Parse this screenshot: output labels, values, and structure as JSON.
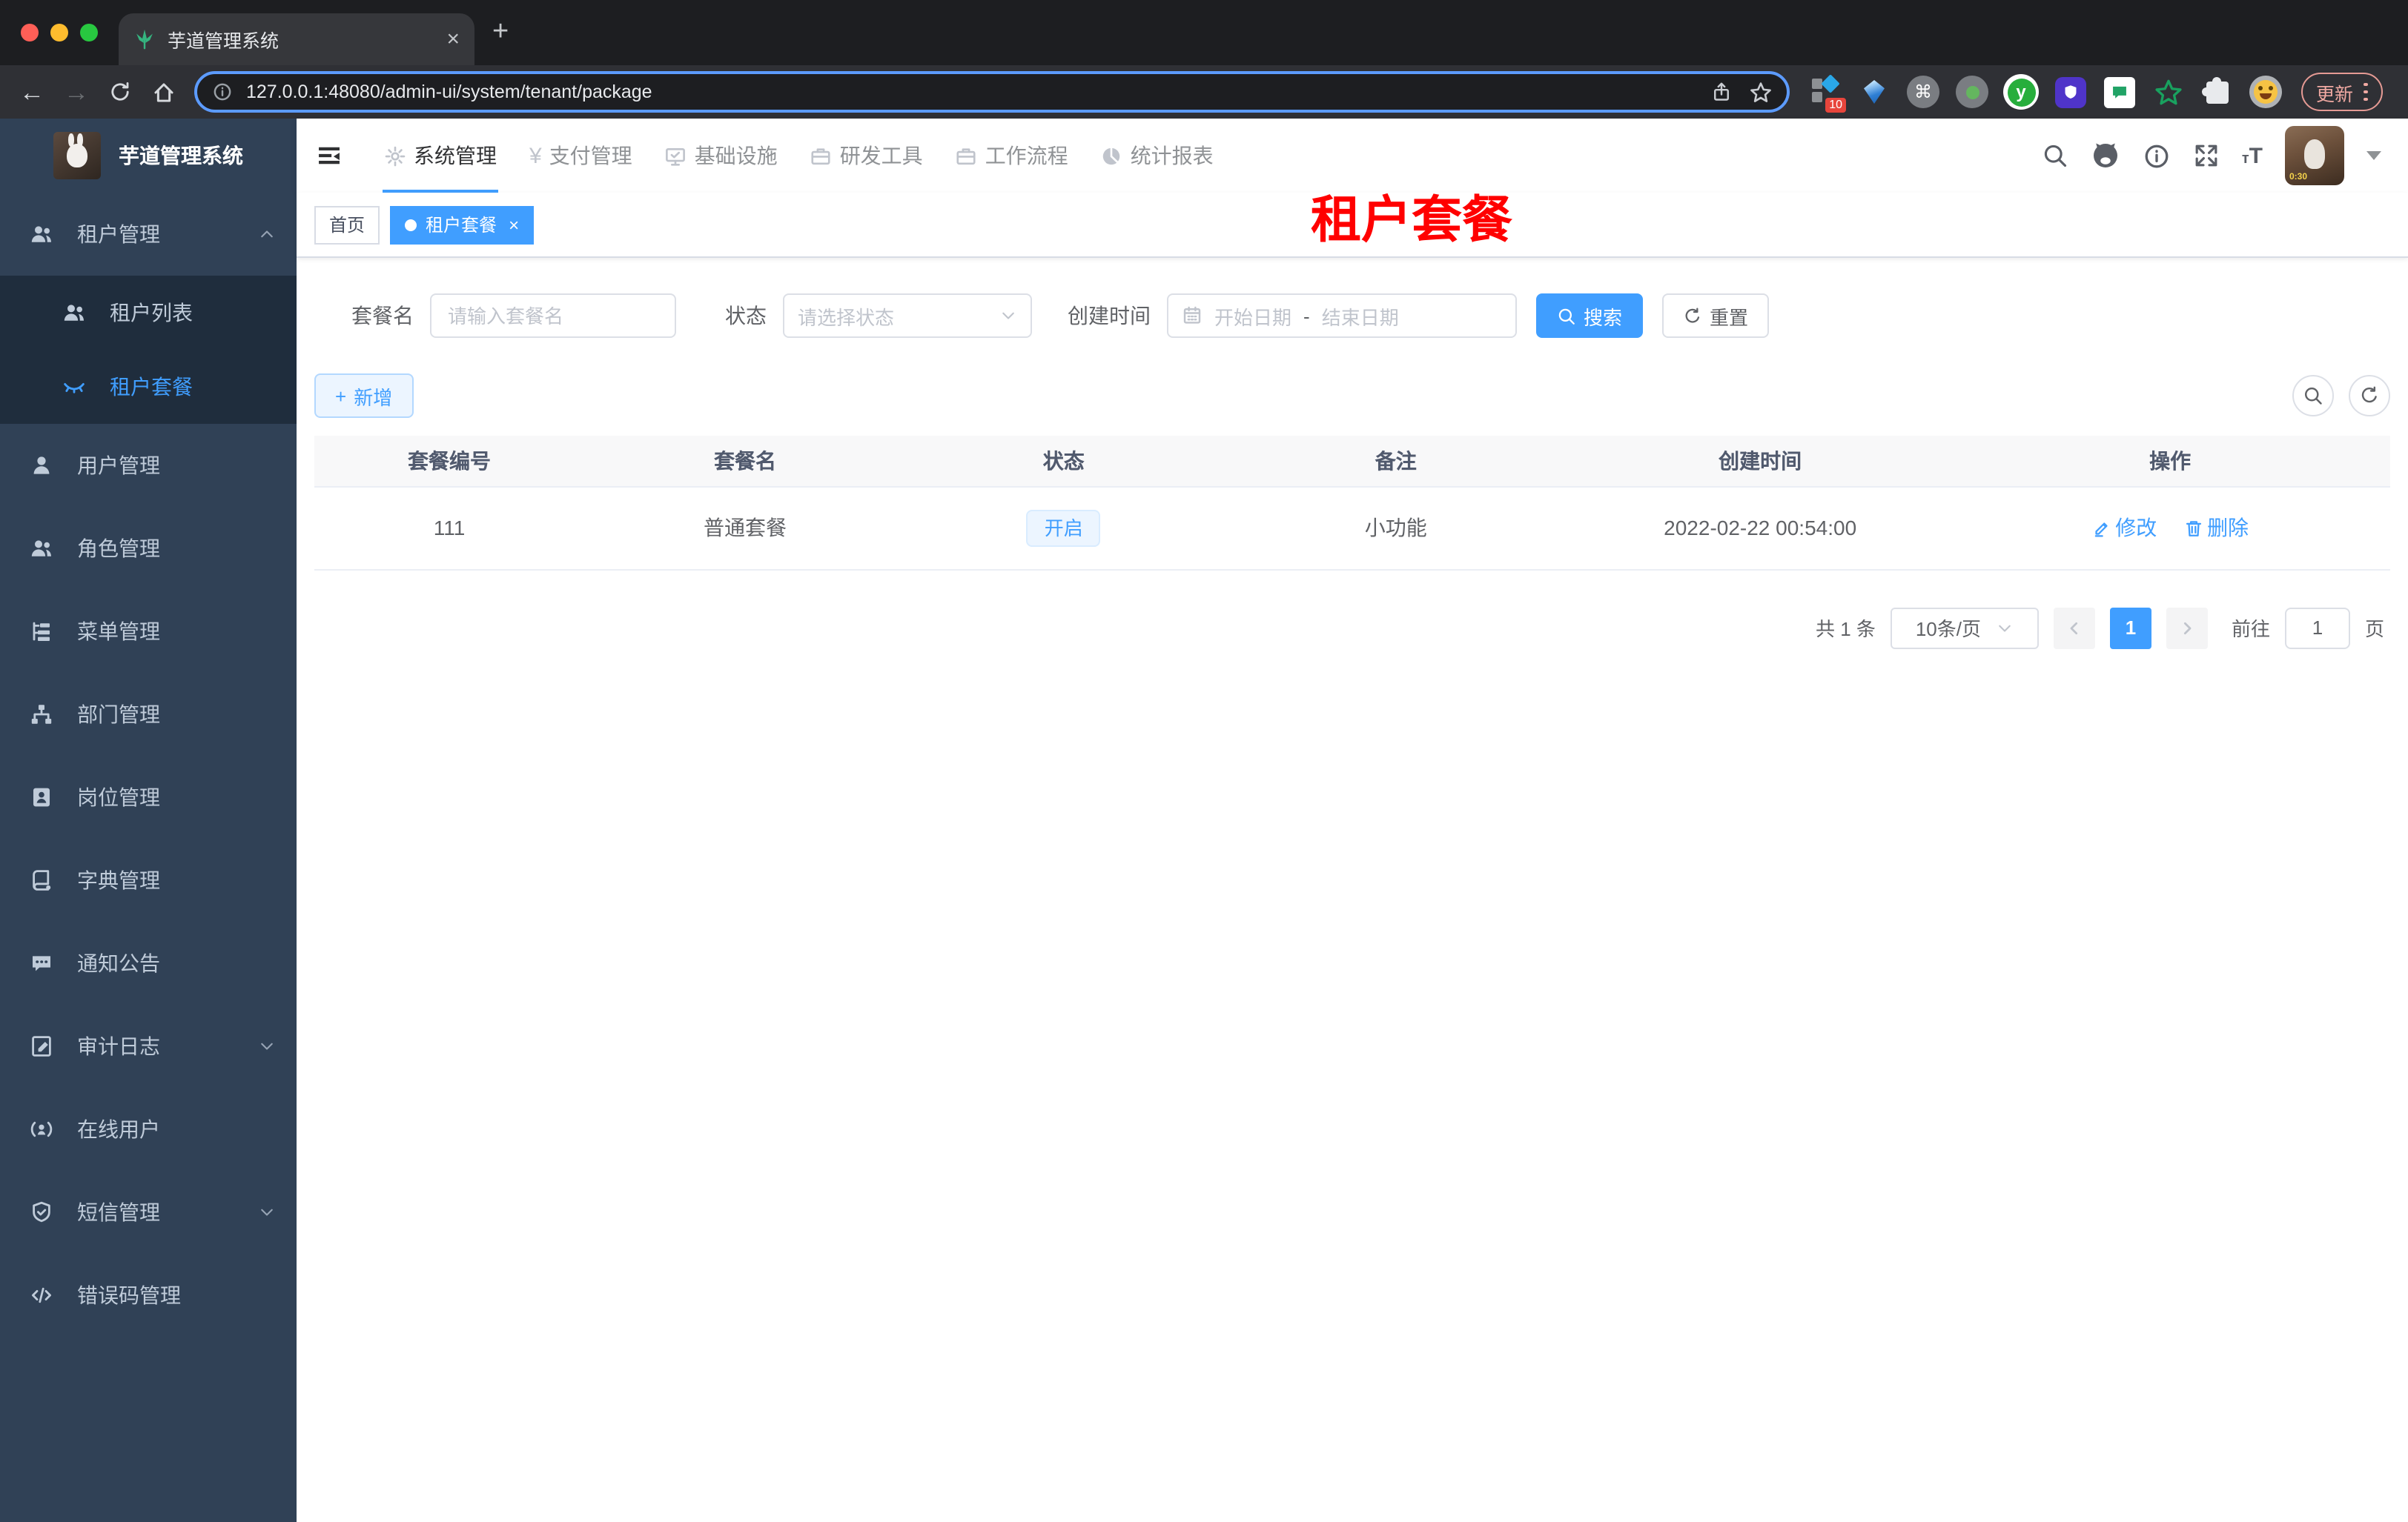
{
  "browser": {
    "tab_title": "芋道管理系统",
    "url": "127.0.0.1:48080/admin-ui/system/tenant/package",
    "update_label": "更新",
    "ext_badge": "10",
    "new_tab": "+",
    "close_tab": "×"
  },
  "app": {
    "logo_title": "芋道管理系统",
    "avatar_caption": "0:30",
    "topnav": [
      {
        "label": "系统管理",
        "icon": "gear-icon",
        "active": true
      },
      {
        "label": "支付管理",
        "icon": "yen-icon",
        "active": false
      },
      {
        "label": "基础设施",
        "icon": "monitor-icon",
        "active": false
      },
      {
        "label": "研发工具",
        "icon": "briefcase-icon",
        "active": false
      },
      {
        "label": "工作流程",
        "icon": "briefcase-icon",
        "active": false
      },
      {
        "label": "统计报表",
        "icon": "dashboard-icon",
        "active": false
      }
    ]
  },
  "sidebar": {
    "items": [
      {
        "label": "租户管理",
        "icon": "peoples-icon",
        "expanded": true
      },
      {
        "label": "租户列表",
        "icon": "peoples-icon"
      },
      {
        "label": "租户套餐",
        "icon": "eye-icon",
        "active": true
      },
      {
        "label": "用户管理",
        "icon": "user-icon"
      },
      {
        "label": "角色管理",
        "icon": "peoples-icon"
      },
      {
        "label": "菜单管理",
        "icon": "tree-table-icon"
      },
      {
        "label": "部门管理",
        "icon": "tree-icon"
      },
      {
        "label": "岗位管理",
        "icon": "post-icon"
      },
      {
        "label": "字典管理",
        "icon": "dict-icon"
      },
      {
        "label": "通知公告",
        "icon": "message-icon"
      },
      {
        "label": "审计日志",
        "icon": "form-icon",
        "collapsible": true
      },
      {
        "label": "在线用户",
        "icon": "online-icon"
      },
      {
        "label": "短信管理",
        "icon": "shield-icon",
        "collapsible": true
      },
      {
        "label": "错误码管理",
        "icon": "code-icon"
      }
    ]
  },
  "tags": {
    "home": "首页",
    "active": "租户套餐",
    "close": "×"
  },
  "page_title_watermark": "租户套餐",
  "filters": {
    "name_label": "套餐名",
    "name_placeholder": "请输入套餐名",
    "status_label": "状态",
    "status_placeholder": "请选择状态",
    "time_label": "创建时间",
    "start_placeholder": "开始日期",
    "range_separator": "-",
    "end_placeholder": "结束日期",
    "search_label": "搜索",
    "reset_label": "重置"
  },
  "toolbar": {
    "add_label": "新增",
    "plus": "+"
  },
  "table": {
    "headers": [
      "套餐编号",
      "套餐名",
      "状态",
      "备注",
      "创建时间",
      "操作"
    ],
    "row": {
      "id": "111",
      "name": "普通套餐",
      "status": "开启",
      "remark": "小功能",
      "created": "2022-02-22 00:54:00",
      "edit_label": "修改",
      "delete_label": "删除"
    }
  },
  "pagination": {
    "total": "共 1 条",
    "page_size": "10条/页",
    "page": "1",
    "goto_label": "前往",
    "goto_value": "1",
    "unit_label": "页"
  },
  "colors": {
    "accent": "#409eff",
    "sidebar_bg": "#304156",
    "submenu_bg": "#1f2d3d",
    "status_tag_bg": "#ecf5ff",
    "watermark_red": "#ff0000"
  }
}
